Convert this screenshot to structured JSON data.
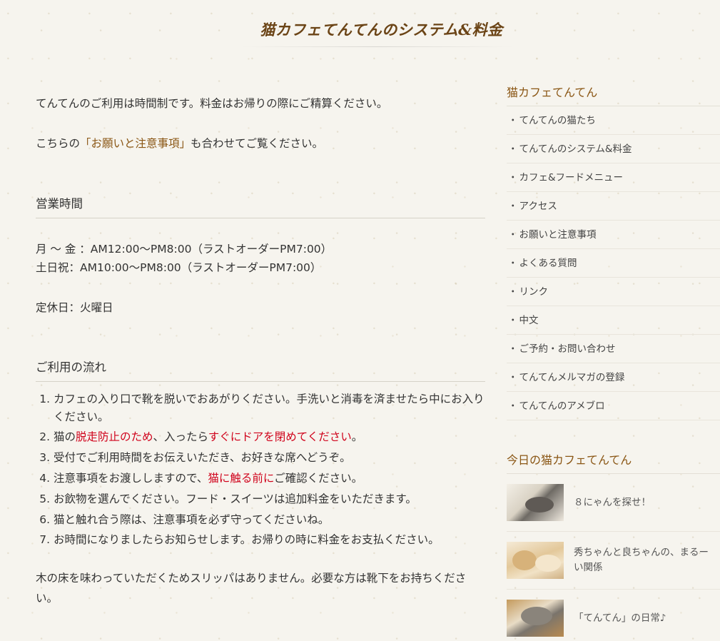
{
  "page": {
    "title": "猫カフェてんてんのシステム&料金"
  },
  "main": {
    "intro": "てんてんのご利用は時間制です。料金はお帰りの際にご精算ください。",
    "note_prefix": "こちらの",
    "note_link": "「お願いと注意事項」",
    "note_suffix": "も合わせてご覧ください。",
    "hours_heading": "営業時間",
    "hours_weekday": "月 ～ 金 ：AM12:00～PM8:00（ラストオーダーPM7:00）",
    "hours_weekend": "土日祝：AM10:00～PM8:00（ラストオーダーPM7:00）",
    "holiday": "定休日：火曜日",
    "flow_heading": "ご利用の流れ",
    "flow": {
      "step1": "カフェの入り口で靴を脱いでおあがりください。手洗いと消毒を済ませたら中にお入りください。",
      "step2_a": "猫の",
      "step2_red1": "脱走防止のため",
      "step2_b": "、入ったら",
      "step2_red2": "すぐにドアを閉めてください",
      "step2_c": "。",
      "step3": "受付でご利用時間をお伝えいただき、お好きな席へどうぞ。",
      "step4_a": "注意事項をお渡ししますので、",
      "step4_red": "猫に触る前に",
      "step4_b": "ご確認ください。",
      "step5": "お飲物を選んでください。フード・スイーツは追加料金をいただきます。",
      "step6": "猫と触れ合う際は、注意事項を必ず守ってくださいね。",
      "step7": "お時間になりましたらお知らせします。お帰りの時に料金をお支払ください。"
    },
    "slipper_note": "木の床を味わっていただくためスリッパはありません。必要な方は靴下をお持ちください。"
  },
  "sidebar": {
    "menu_title": "猫カフェてんてん",
    "bullet": "・",
    "menu_items": [
      "てんてんの猫たち",
      "てんてんのシステム&料金",
      "カフェ&フードメニュー",
      "アクセス",
      "お願いと注意事項",
      "よくある質問",
      "リンク",
      "中文",
      "ご予約・お問い合わせ",
      "てんてんメルマガの登録",
      "てんてんのアメブロ"
    ],
    "today_title": "今日の猫カフェてんてん",
    "posts": [
      "８にゃんを探せ！",
      "秀ちゃんと良ちゃんの、まるーい関係",
      "「てんてん」の日常♪"
    ]
  },
  "colors": {
    "accent_brown": "#8a5614",
    "title_brown": "#6b4416",
    "warning_red": "#d0021b",
    "background": "#f6f4ee"
  }
}
